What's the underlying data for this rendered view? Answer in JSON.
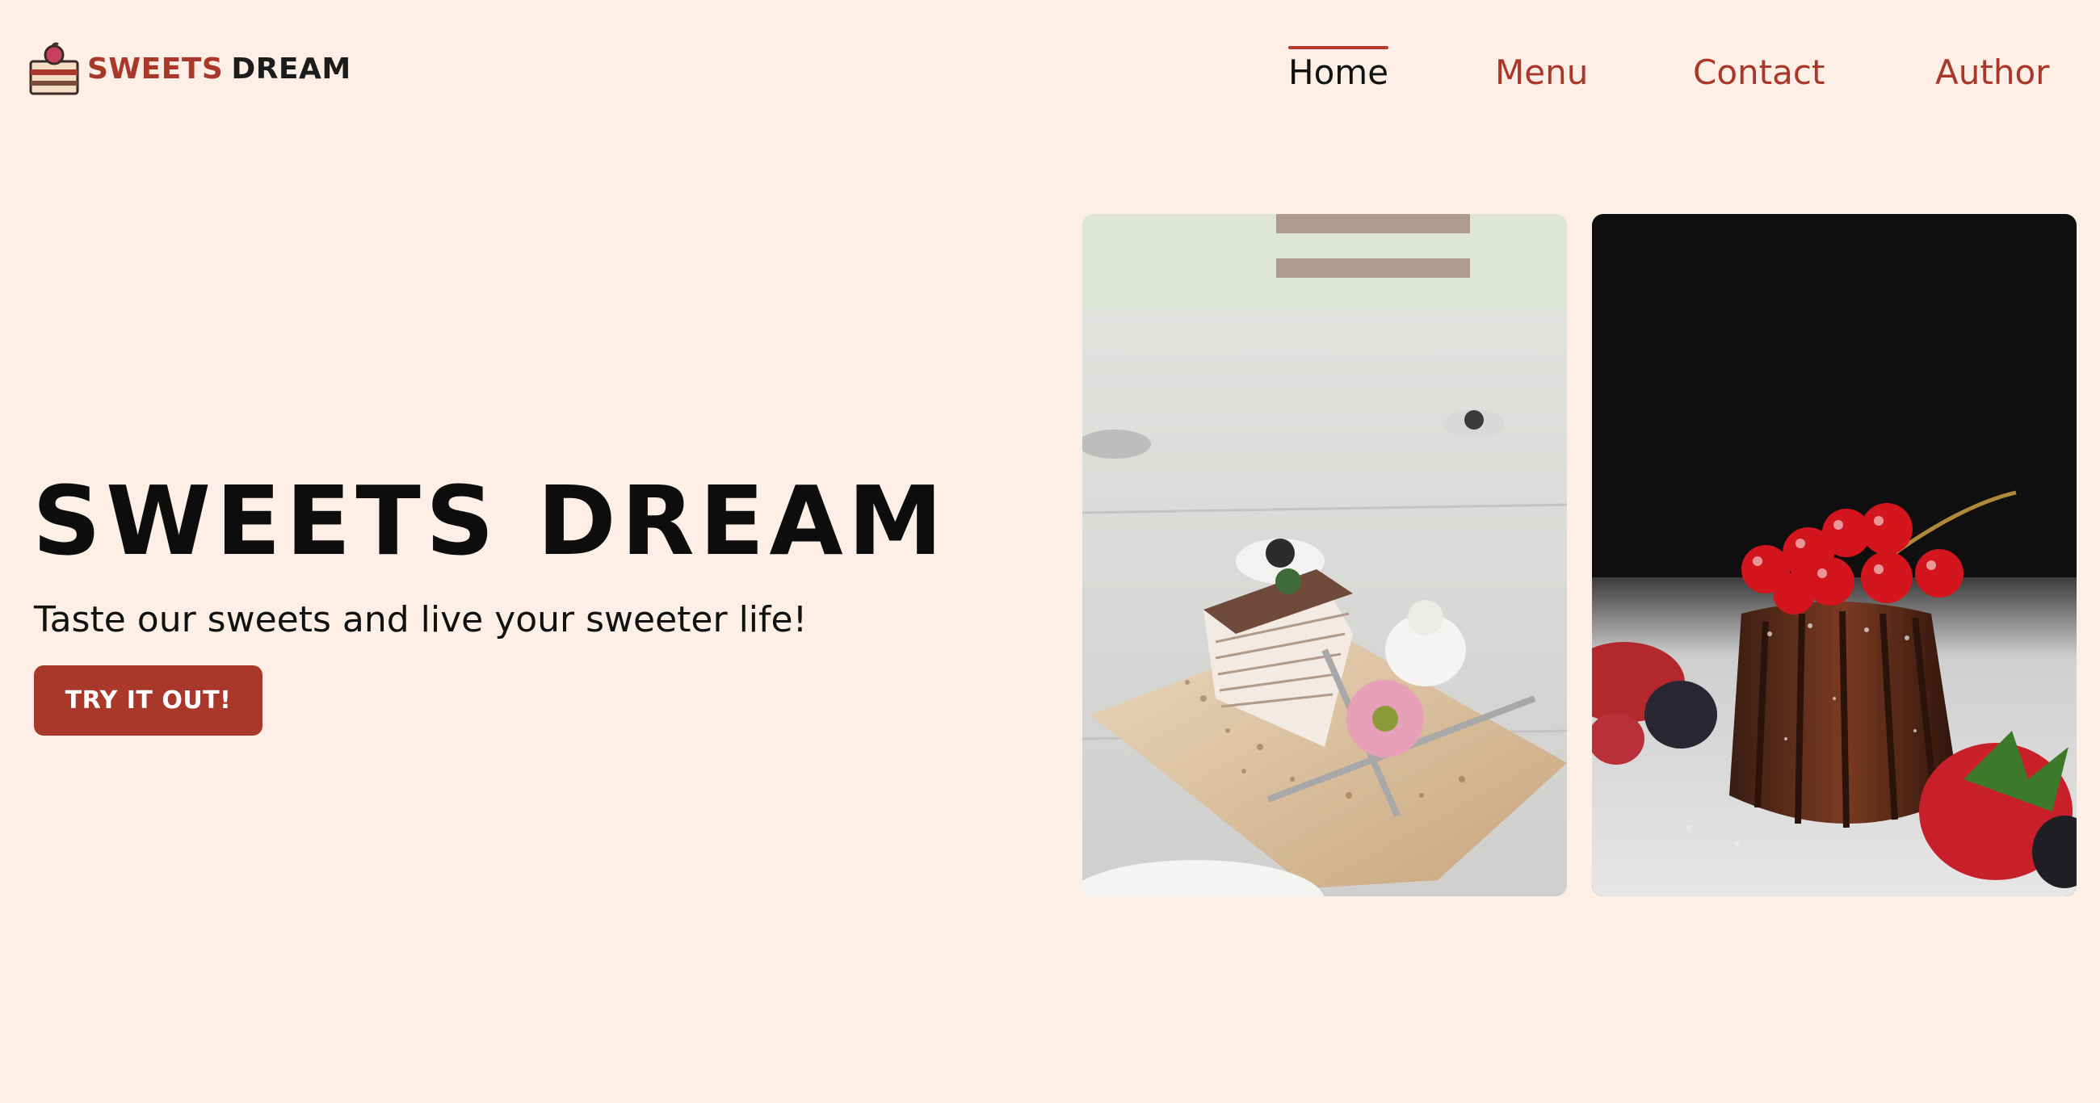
{
  "brand": {
    "word1": "SWEETS",
    "word2": "DREAM",
    "logo_icon": "cake-slice-icon"
  },
  "nav": {
    "items": [
      {
        "label": "Home",
        "active": true
      },
      {
        "label": "Menu",
        "active": false
      },
      {
        "label": "Contact",
        "active": false
      },
      {
        "label": "Author",
        "active": false
      }
    ]
  },
  "hero": {
    "title": "SWEETS DREAM",
    "subtitle": "Taste our sweets and live your sweeter life!",
    "cta_label": "TRY IT OUT!"
  },
  "gallery": {
    "images": [
      {
        "name": "crepe-cake-photo"
      },
      {
        "name": "canele-with-berries-photo"
      }
    ]
  },
  "colors": {
    "background": "#fdeee6",
    "accent": "#a9372a",
    "text": "#111111"
  }
}
